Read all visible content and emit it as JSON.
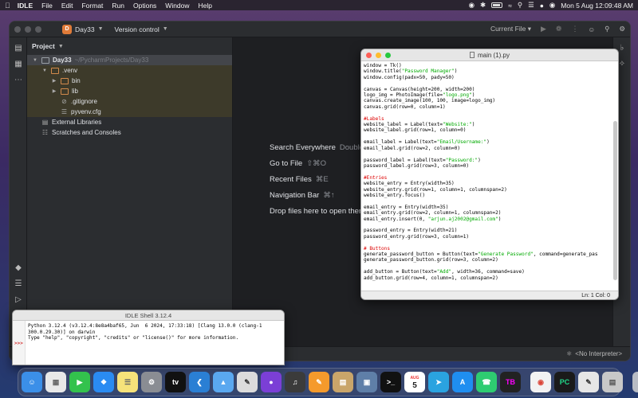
{
  "menubar": {
    "app_name": "IDLE",
    "items": [
      "File",
      "Edit",
      "Format",
      "Run",
      "Options",
      "Window",
      "Help"
    ],
    "datetime": "Mon 5 Aug  12:09:48 AM"
  },
  "pycharm": {
    "project_badge": "D",
    "project_name": "Day33",
    "vcs_label": "Version control",
    "run_config": "Current File",
    "panel_title": "Project",
    "tree": [
      {
        "label": "Day33",
        "path": "~/PycharmProjects/Day33",
        "type": "folder"
      },
      {
        "label": ".venv",
        "type": "folder-orange"
      },
      {
        "label": "bin",
        "type": "folder-orange"
      },
      {
        "label": "lib",
        "type": "folder-orange"
      },
      {
        "label": ".gitignore",
        "type": "file"
      },
      {
        "label": "pyvenv.cfg",
        "type": "file"
      },
      {
        "label": "External Libraries",
        "type": "lib"
      },
      {
        "label": "Scratches and Consoles",
        "type": "scratch"
      }
    ],
    "hints": [
      {
        "label": "Search Everywhere",
        "shortcut": "Double"
      },
      {
        "label": "Go to File",
        "shortcut": "⇧⌘O"
      },
      {
        "label": "Recent Files",
        "shortcut": "⌘E"
      },
      {
        "label": "Navigation Bar",
        "shortcut": "⌘↑"
      },
      {
        "label": "Drop files here to open ther",
        "shortcut": ""
      }
    ],
    "status_interpreter": "<No Interpreter>"
  },
  "idle_editor": {
    "title": "main (1).py",
    "status": "Ln: 1  Col: 0"
  },
  "idle_shell": {
    "title": "IDLE Shell 3.12.4",
    "lines": [
      "Python 3.12.4 (v3.12.4:8e8a4baf65, Jun  6 2024, 17:33:18) [Clang 13.0.0 (clang-1",
      "300.0.29.30)] on darwin",
      "Type \"help\", \"copyright\", \"credits\" or \"license()\" for more information."
    ],
    "prompt": ">>>"
  },
  "dock": {
    "calendar_month": "AUG",
    "calendar_day": "5"
  }
}
